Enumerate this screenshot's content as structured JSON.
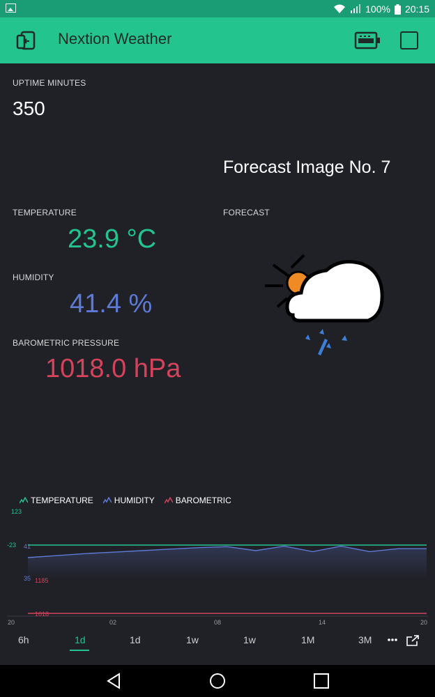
{
  "status_bar": {
    "battery": "100%",
    "time": "20:15"
  },
  "app_bar": {
    "title": "Nextion Weather"
  },
  "uptime": {
    "label": "UPTIME MINUTES",
    "value": "350"
  },
  "forecast": {
    "caption": "Forecast Image No. 7",
    "label": "FORECAST",
    "icon": "partly-cloudy-rain-icon"
  },
  "temperature": {
    "label": "TEMPERATURE",
    "value": "23.9 °C",
    "color": "#23c48e"
  },
  "humidity": {
    "label": "HUMIDITY",
    "value": "41.4 %",
    "color": "#5f7ad5"
  },
  "pressure": {
    "label": "BAROMETRIC PRESSURE",
    "value": "1018.0 hPa",
    "color": "#d3435c"
  },
  "chart_data": {
    "type": "line",
    "legend": [
      "TEMPERATURE",
      "HUMIDITY",
      "BAROMETRIC"
    ],
    "x_ticks": [
      "20",
      "02",
      "08",
      "14",
      "20"
    ],
    "y_tick_labels": [
      "123",
      "23",
      "41",
      "35",
      "1185",
      "1018"
    ],
    "series": [
      {
        "name": "TEMPERATURE",
        "color": "#23c48e",
        "values": [
          23,
          23,
          23,
          23,
          23,
          23,
          23,
          23,
          23,
          23,
          23,
          23,
          23,
          23,
          23
        ]
      },
      {
        "name": "HUMIDITY",
        "color": "#5f7ad5",
        "values": [
          39.2,
          39.6,
          40.0,
          40.3,
          40.6,
          40.9,
          41.2,
          41.4,
          40.6,
          41.5,
          40.4,
          41.5,
          40.4,
          41.0,
          41.0
        ]
      },
      {
        "name": "BAROMETRIC",
        "color": "#d3435c",
        "values": [
          1018,
          1018,
          1018,
          1018,
          1018,
          1018,
          1018,
          1018,
          1018,
          1018,
          1018,
          1018,
          1018,
          1018,
          1018
        ]
      }
    ]
  },
  "time_ranges": [
    "6h",
    "1d",
    "1d",
    "1w",
    "1w",
    "1M",
    "3M"
  ],
  "active_range": "1d"
}
